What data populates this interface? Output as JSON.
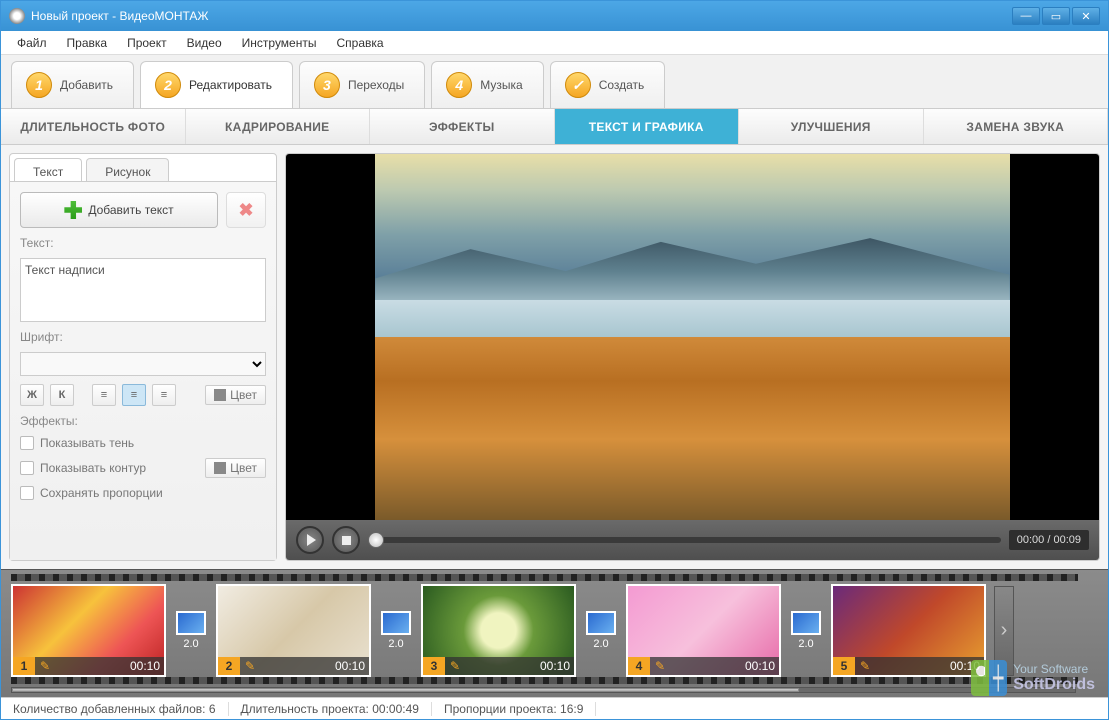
{
  "title": "Новый проект - ВидеоМОНТАЖ",
  "menubar": [
    "Файл",
    "Правка",
    "Проект",
    "Видео",
    "Инструменты",
    "Справка"
  ],
  "steps": [
    {
      "num": "1",
      "label": "Добавить"
    },
    {
      "num": "2",
      "label": "Редактировать"
    },
    {
      "num": "3",
      "label": "Переходы"
    },
    {
      "num": "4",
      "label": "Музыка"
    },
    {
      "num": "✓",
      "label": "Создать"
    }
  ],
  "subtabs": [
    "ДЛИТЕЛЬНОСТЬ ФОТО",
    "КАДРИРОВАНИЕ",
    "ЭФФЕКТЫ",
    "ТЕКСТ И ГРАФИКА",
    "УЛУЧШЕНИЯ",
    "ЗАМЕНА ЗВУКА"
  ],
  "side": {
    "tabs": [
      "Текст",
      "Рисунок"
    ],
    "add_text_btn": "Добавить текст",
    "label_text": "Текст:",
    "text_value": "Текст надписи",
    "label_font": "Шрифт:",
    "bold": "Ж",
    "italic": "К",
    "color_btn": "Цвет",
    "label_effects": "Эффекты:",
    "chk_shadow": "Показывать тень",
    "chk_outline": "Показывать контур",
    "chk_keep_ratio": "Сохранять пропорции"
  },
  "player": {
    "time": "00:00 / 00:09"
  },
  "timeline": {
    "clips": [
      {
        "idx": "1",
        "time": "00:10"
      },
      {
        "idx": "2",
        "time": "00:10"
      },
      {
        "idx": "3",
        "time": "00:10"
      },
      {
        "idx": "4",
        "time": "00:10"
      },
      {
        "idx": "5",
        "time": "00:10"
      }
    ],
    "transition_duration": "2.0"
  },
  "status": {
    "files_label": "Количество добавленных файлов:",
    "files_value": "6",
    "duration_label": "Длительность проекта:",
    "duration_value": "00:00:49",
    "aspect_label": "Пропорции проекта:",
    "aspect_value": "16:9"
  },
  "watermark": {
    "line1": "Your Software",
    "line2": "SoftDroids"
  }
}
